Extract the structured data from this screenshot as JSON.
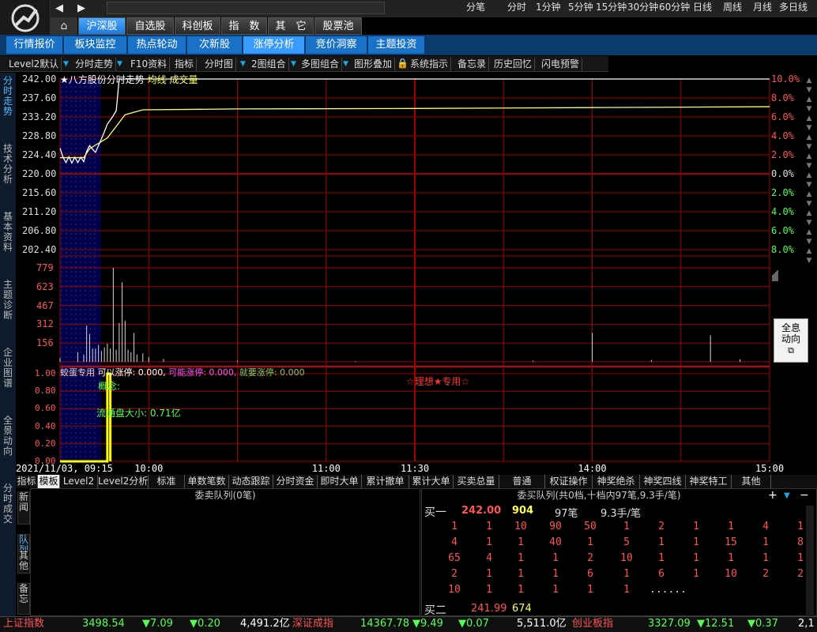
{
  "window": {
    "back_icon": "back-arrow-icon",
    "forward_icon": "forward-arrow-icon",
    "timeframes": [
      "分笔",
      "分时",
      "1分钟",
      "5分钟",
      "15分钟",
      "30分钟",
      "60分钟",
      "日线",
      "周线",
      "月线",
      "多日线"
    ]
  },
  "top_tabs": [
    "沪深股",
    "自选股",
    "科创板",
    "指　数",
    "其　它",
    "股票池"
  ],
  "sub_tabs": [
    "行情报价",
    "板块监控",
    "热点轮动",
    "次新股",
    "涨停分析",
    "竞价洞察",
    "主题投资"
  ],
  "toolbar": [
    "Level2默认",
    "分时走势",
    "F10资料",
    "指标",
    "分时图",
    "2图组合",
    "多图组合",
    "图形叠加",
    "系统指示",
    "备忘录",
    "历史回忆",
    "闪电预警"
  ],
  "left_tabs": [
    "分时走势",
    "技术分析",
    "基本资料",
    "主题诊断",
    "企业图谱",
    "全景动向",
    "分时成交"
  ],
  "chart": {
    "legend_title": "★八方股份分时走势",
    "legend_avg": "均线",
    "legend_vol": "成交量",
    "price_labels": [
      "242.00",
      "237.60",
      "233.20",
      "228.80",
      "224.40",
      "220.00",
      "215.60",
      "211.20",
      "206.80",
      "202.40"
    ],
    "pct_labels": [
      "10.0%",
      "8.0%",
      "6.0%",
      "4.0%",
      "2.0%",
      "0.0%",
      "2.0%",
      "4.0%",
      "6.0%",
      "8.0%"
    ],
    "vol_labels": [
      "779",
      "623",
      "467",
      "312",
      "156"
    ],
    "indicator_name": "蛟蛋专用",
    "ind_a": "可以涨停: 0.000,",
    "ind_b": "可能涨停: 0.000,",
    "ind_c": "就要涨停: 0.000",
    "ind_center": "☆理想★专用☆",
    "ind_concept": "概念:",
    "ind_float": "流通盘大小: 0.71亿",
    "ind_labels": [
      "1.00",
      "0.80",
      "0.60",
      "0.40",
      "0.20",
      "0.00"
    ],
    "time_labels": [
      "2021/11/03, 09:15",
      "10:00",
      "11:00",
      "11:30",
      "14:00",
      "15:00"
    ],
    "panorama_label": "全息动向"
  },
  "chart_data": {
    "type": "line",
    "title": "★八方股份分时走势",
    "series": [
      {
        "name": "分时走势",
        "color": "#ffffff",
        "points": [
          [
            0,
            226.5
          ],
          [
            1,
            224.5
          ],
          [
            2,
            223.3
          ],
          [
            3,
            224.6
          ],
          [
            4,
            223.2
          ],
          [
            5,
            224.5
          ],
          [
            6,
            223.3
          ],
          [
            7,
            224.5
          ],
          [
            8,
            223.5
          ],
          [
            9,
            225.8
          ],
          [
            10,
            227.1
          ],
          [
            11,
            226.3
          ],
          [
            12,
            225.6
          ],
          [
            13,
            227.1
          ],
          [
            14,
            228.6
          ],
          [
            15,
            230.2
          ],
          [
            16,
            231.9
          ],
          [
            17,
            232.8
          ],
          [
            18,
            233.8
          ],
          [
            19,
            234.9
          ],
          [
            20,
            242.0
          ],
          [
            240,
            242.0
          ]
        ]
      },
      {
        "name": "均线",
        "color": "#ffff66",
        "points": [
          [
            0,
            224.4
          ],
          [
            8,
            224.4
          ],
          [
            10,
            226.4
          ],
          [
            16,
            228.8
          ],
          [
            22,
            234.0
          ],
          [
            28,
            235.1
          ],
          [
            60,
            235.3
          ],
          [
            120,
            235.4
          ],
          [
            180,
            235.6
          ],
          [
            240,
            235.8
          ]
        ]
      }
    ],
    "volume": [
      [
        0,
        30
      ],
      [
        6,
        80
      ],
      [
        8,
        60
      ],
      [
        9,
        300
      ],
      [
        10,
        230
      ],
      [
        11,
        110
      ],
      [
        12,
        110
      ],
      [
        13,
        140
      ],
      [
        14,
        90
      ],
      [
        15,
        120
      ],
      [
        16,
        150
      ],
      [
        17,
        110
      ],
      [
        18,
        779
      ],
      [
        19,
        100
      ],
      [
        20,
        320
      ],
      [
        21,
        660
      ],
      [
        22,
        340
      ],
      [
        23,
        100
      ],
      [
        24,
        80
      ],
      [
        25,
        240
      ],
      [
        26,
        60
      ],
      [
        28,
        70
      ],
      [
        30,
        40
      ],
      [
        35,
        25
      ],
      [
        60,
        10
      ],
      [
        100,
        5
      ],
      [
        160,
        10
      ],
      [
        180,
        240
      ],
      [
        200,
        15
      ],
      [
        220,
        220
      ],
      [
        230,
        20
      ]
    ],
    "ylim": [
      202.4,
      242.0
    ],
    "vol_max": 779,
    "indicator": [
      [
        0,
        0
      ],
      [
        16,
        0
      ],
      [
        16,
        1.0
      ],
      [
        17,
        1.0
      ],
      [
        17,
        0
      ]
    ]
  },
  "bottom_tabs": [
    "指标",
    "模板",
    "Level2",
    "Level2分析",
    "标准",
    "单数笔数",
    "动态跟踪",
    "分时资金",
    "即时大单",
    "累计撤单",
    "累计大单",
    "买卖总量",
    "普通",
    "权证操作",
    "神奖绝杀",
    "神奖四线",
    "神奖特工",
    "其他"
  ],
  "side_tabs": [
    "新闻",
    "队列",
    "其他",
    "备忘"
  ],
  "queue_left": {
    "title": "委卖队列(0笔)"
  },
  "queue_right": {
    "title": "委买队列(共0档,十档内97笔,9.3手/笔)",
    "buy1_label": "买一",
    "buy1_price": "242.00",
    "buy1_vol": "904",
    "buy1_count": "97笔",
    "buy1_avg": "9.3手/笔",
    "rows": [
      [
        "1",
        "1",
        "10",
        "90",
        "50",
        "1",
        "2",
        "1",
        "1",
        "4",
        "1"
      ],
      [
        "4",
        "1",
        "1",
        "40",
        "1",
        "5",
        "1",
        "1",
        "15",
        "1",
        "8"
      ],
      [
        "65",
        "4",
        "1",
        "1",
        "2",
        "10",
        "1",
        "1",
        "1",
        "1",
        "1"
      ],
      [
        "2",
        "1",
        "1",
        "1",
        "6",
        "1",
        "6",
        "1",
        "10",
        "2",
        "2"
      ],
      [
        "10",
        "1",
        "1",
        "1",
        "1",
        "1",
        "......"
      ]
    ],
    "buy2_label": "买二",
    "buy2_price": "241.99",
    "buy2_vol": "674",
    "plus": "+",
    "arrow": "▼",
    "minus": "−"
  },
  "status": {
    "sh_name": "上证指数",
    "sh_val": "3498.54",
    "sh_chg": "▼7.09",
    "sh_pct": "▼0.20",
    "sh_amt": "4,491.2亿",
    "sz_name": "深证成指",
    "sz_val": "14367.78",
    "sz_chg": "▼9.49",
    "sz_pct": "▼0.07",
    "sz_amt": "5,511.0亿",
    "cy_name": "创业板指",
    "cy_val": "3327.09",
    "cy_chg": "▼12.51",
    "cy_pct": "▼0.37",
    "cy_amt": "2,1"
  }
}
